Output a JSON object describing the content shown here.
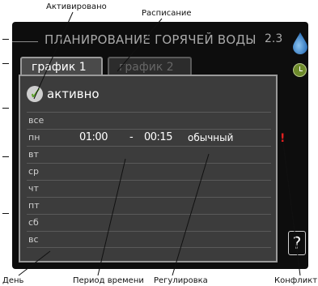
{
  "annotations": {
    "activated": "Активировано",
    "schedule": "Расписание",
    "day": "День",
    "time_period": "Период времени",
    "adjustment": "Регулировка",
    "conflict": "Конфликт"
  },
  "header": {
    "title": "ПЛАНИРОВАНИЕ ГОРЯЧЕЙ ВОДЫ",
    "page_number": "2.3"
  },
  "icons": {
    "water": "water-drop-icon",
    "clock": "clock-icon",
    "help": "help-icon",
    "check": "checkmark-icon",
    "conflict": "exclamation-icon"
  },
  "tabs": [
    {
      "label": "график 1",
      "active": true
    },
    {
      "label": "график 2",
      "active": false
    }
  ],
  "schedule": {
    "enabled_label": "активно",
    "enabled": true,
    "days": [
      {
        "day": "все",
        "start": "",
        "end": "",
        "mode": ""
      },
      {
        "day": "пн",
        "start": "01:00",
        "end": "00:15",
        "mode": "обычный",
        "separator": "-"
      },
      {
        "day": "вт",
        "start": "",
        "end": "",
        "mode": ""
      },
      {
        "day": "ср",
        "start": "",
        "end": "",
        "mode": ""
      },
      {
        "day": "чт",
        "start": "",
        "end": "",
        "mode": ""
      },
      {
        "day": "пт",
        "start": "",
        "end": "",
        "mode": ""
      },
      {
        "day": "сб",
        "start": "",
        "end": "",
        "mode": ""
      },
      {
        "day": "вс",
        "start": "",
        "end": "",
        "mode": ""
      }
    ]
  },
  "conflict_marker": "!",
  "help_label": "?",
  "colors": {
    "screen_bg": "#0d0d0d",
    "panel_bg": "#3c3c3c",
    "check_green": "#5fa52c",
    "conflict_red": "#e02020",
    "water_blue": "#4a8fd0"
  }
}
